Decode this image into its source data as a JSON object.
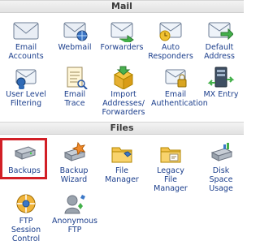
{
  "sections": {
    "mail": {
      "title": "Mail"
    },
    "files": {
      "title": "Files"
    }
  },
  "mail_items": [
    {
      "label": "Email\nAccounts",
      "icon": "envelope-icon"
    },
    {
      "label": "Webmail",
      "icon": "webmail-envelope-icon"
    },
    {
      "label": "Forwarders",
      "icon": "forward-envelope-icon"
    },
    {
      "label": "Auto\nResponders",
      "icon": "auto-responder-icon"
    },
    {
      "label": "Default\nAddress",
      "icon": "default-address-icon"
    },
    {
      "label": "User Level\nFiltering",
      "icon": "filter-icon"
    },
    {
      "label": "Email\nTrace",
      "icon": "trace-icon"
    },
    {
      "label": "Import\nAddresses/\nForwarders",
      "icon": "import-box-icon"
    },
    {
      "label": "Email\nAuthentication",
      "icon": "authentication-icon"
    },
    {
      "label": "MX Entry",
      "icon": "mx-entry-icon"
    }
  ],
  "file_items": [
    {
      "label": "Backups",
      "icon": "drive-icon"
    },
    {
      "label": "Backup\nWizard",
      "icon": "wizard-drive-icon"
    },
    {
      "label": "File\nManager",
      "icon": "folder-icon"
    },
    {
      "label": "Legacy\nFile\nManager",
      "icon": "legacy-folder-icon"
    },
    {
      "label": "Disk\nSpace\nUsage",
      "icon": "disk-usage-icon"
    },
    {
      "label": "FTP\nSession\nControl",
      "icon": "ftp-session-icon"
    },
    {
      "label": "Anonymous\nFTP",
      "icon": "anonymous-ftp-icon"
    }
  ],
  "highlight_color": "#d21f26",
  "link_color": "#1b3e8c"
}
